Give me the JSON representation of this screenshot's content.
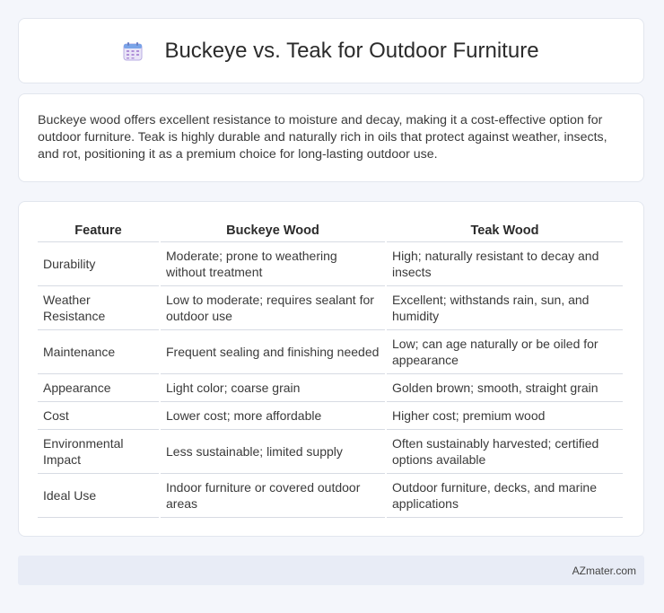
{
  "header": {
    "title": "Buckeye vs. Teak for Outdoor Furniture",
    "icon": "calendar-icon"
  },
  "intro": {
    "text": "Buckeye wood offers excellent resistance to moisture and decay, making it a cost-effective option for outdoor furniture. Teak is highly durable and naturally rich in oils that protect against weather, insects, and rot, positioning it as a premium choice for long-lasting outdoor use."
  },
  "table": {
    "headers": [
      "Feature",
      "Buckeye Wood",
      "Teak Wood"
    ],
    "rows": [
      [
        "Durability",
        "Moderate; prone to weathering without treatment",
        "High; naturally resistant to decay and insects"
      ],
      [
        "Weather Resistance",
        "Low to moderate; requires sealant for outdoor use",
        "Excellent; withstands rain, sun, and humidity"
      ],
      [
        "Maintenance",
        "Frequent sealing and finishing needed",
        "Low; can age naturally or be oiled for appearance"
      ],
      [
        "Appearance",
        "Light color; coarse grain",
        "Golden brown; smooth, straight grain"
      ],
      [
        "Cost",
        "Lower cost; more affordable",
        "Higher cost; premium wood"
      ],
      [
        "Environmental Impact",
        "Less sustainable; limited supply",
        "Often sustainably harvested; certified options available"
      ],
      [
        "Ideal Use",
        "Indoor furniture or covered outdoor areas",
        "Outdoor furniture, decks, and marine applications"
      ]
    ]
  },
  "footer": {
    "brand": "AZmater.com"
  }
}
